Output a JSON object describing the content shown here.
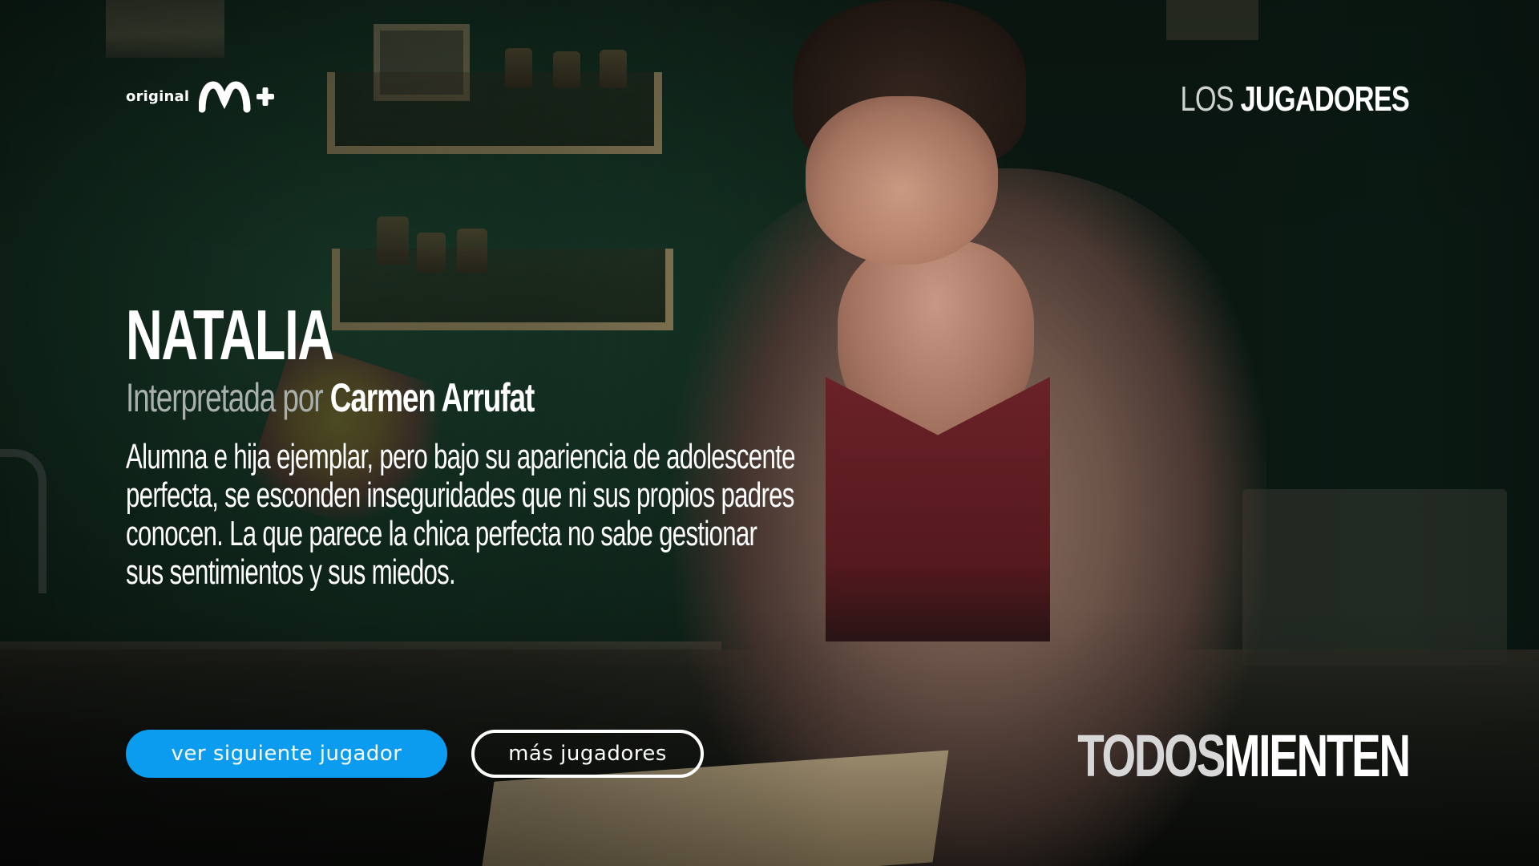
{
  "brand": {
    "original_label": "original",
    "logo_name": "movistar-plus-logo",
    "logo_text": "M+"
  },
  "section": {
    "title_light": "LOS",
    "title_bold": "JUGADORES"
  },
  "character": {
    "name": "NATALIA",
    "played_by_label": "Interpretada por",
    "actor": "Carmen Arrufat",
    "description": "Alumna e hija ejemplar, pero bajo su apariencia de adolescente perfecta, se esconden inseguridades que ni sus propios padres conocen. La que parece la chica perfecta no sabe gestionar sus sentimientos y sus miedos."
  },
  "buttons": {
    "next_label": "ver siguiente jugador",
    "more_label": "más jugadores"
  },
  "show": {
    "title_part1": "TODOS",
    "title_part2": "MIENTEN"
  },
  "colors": {
    "primary_button": "#0b9cf0",
    "text": "#ffffff",
    "muted_text": "#a9b0ac"
  }
}
